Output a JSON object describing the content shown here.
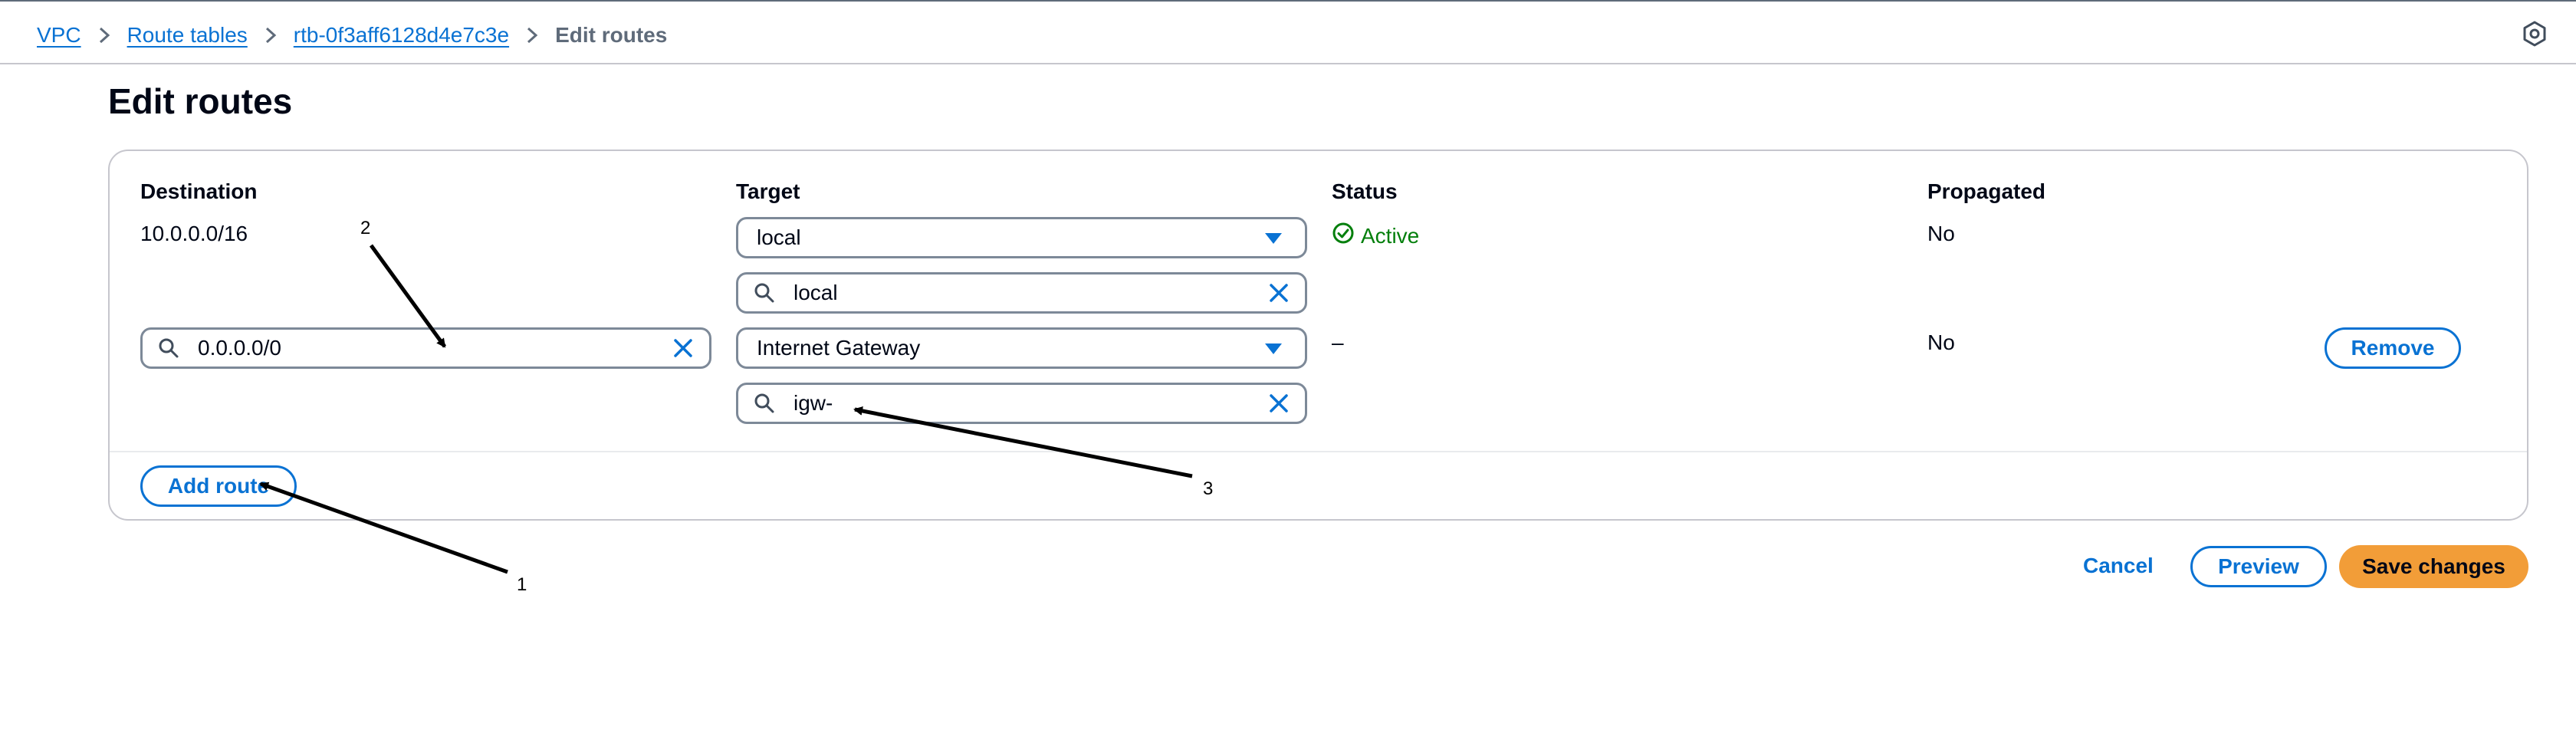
{
  "breadcrumb": {
    "items": [
      "VPC",
      "Route tables",
      "rtb-0f3aff6128d4e7c3e"
    ],
    "current": "Edit routes"
  },
  "page": {
    "title": "Edit routes"
  },
  "table": {
    "headers": {
      "destination": "Destination",
      "target": "Target",
      "status": "Status",
      "propagated": "Propagated"
    },
    "rows": [
      {
        "destination": "10.0.0.0/16",
        "target_select": "local",
        "target_search": "local",
        "status": "Active",
        "propagated": "No"
      },
      {
        "destination_input": "0.0.0.0/0",
        "target_select": "Internet Gateway",
        "target_search": "igw-",
        "status": "–",
        "propagated": "No",
        "remove_label": "Remove"
      }
    ]
  },
  "buttons": {
    "add_route": "Add route",
    "cancel": "Cancel",
    "preview": "Preview",
    "save": "Save changes"
  },
  "annotations": [
    "1",
    "2",
    "3"
  ],
  "colors": {
    "link": "#0972d3",
    "primary_button": "#f29d38",
    "status_success": "#037f0c",
    "border": "#7d8998"
  },
  "icons": {
    "breadcrumb_separator": "chevron-right-icon",
    "help": "hexagon-help-icon",
    "search": "search-icon",
    "clear": "close-icon",
    "dropdown": "caret-down-icon",
    "status": "check-circle-icon"
  }
}
